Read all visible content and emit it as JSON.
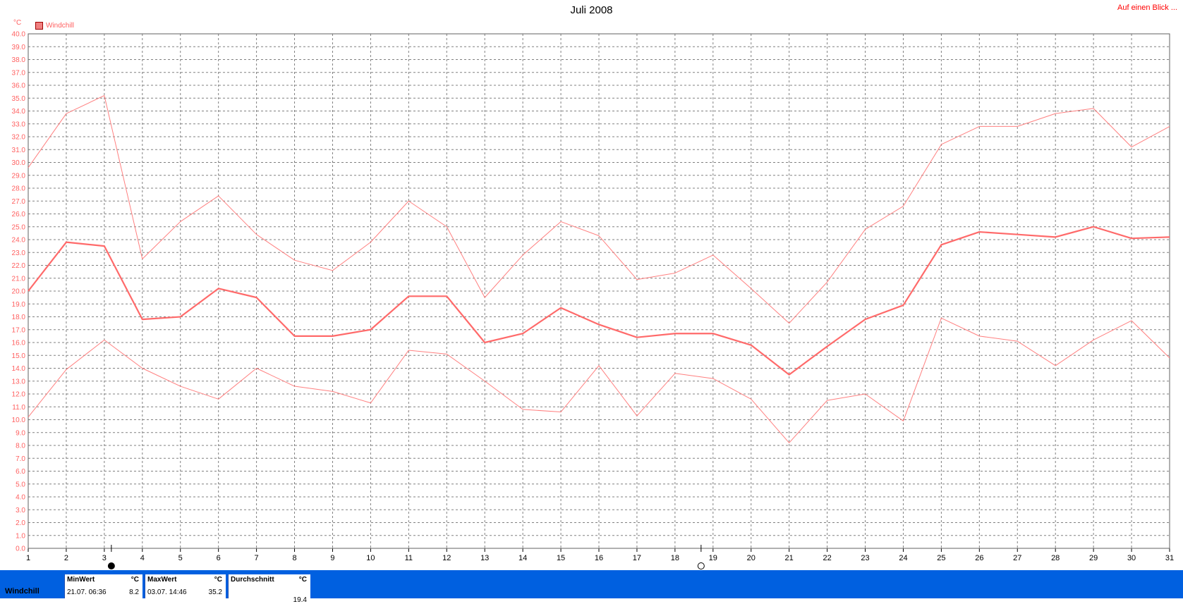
{
  "header": {
    "title": "Juli 2008",
    "link_label": "Auf einen Blick ..."
  },
  "chart_data": {
    "type": "line",
    "title": "Juli 2008",
    "y_unit": "°C",
    "ylim": [
      0,
      40
    ],
    "y_tick_step": 1,
    "x": [
      1,
      2,
      3,
      4,
      5,
      6,
      7,
      8,
      9,
      10,
      11,
      12,
      13,
      14,
      15,
      16,
      17,
      18,
      19,
      20,
      21,
      22,
      23,
      24,
      25,
      26,
      27,
      28,
      29,
      30,
      31
    ],
    "legend": [
      "Windchill"
    ],
    "legend_position": "top-left",
    "grid": true,
    "series": [
      {
        "name": "Windchill",
        "role": "max",
        "color": "#ff8080",
        "values": [
          29.6,
          33.8,
          35.2,
          22.5,
          25.4,
          27.4,
          24.4,
          22.4,
          21.6,
          23.8,
          27.0,
          25.0,
          19.5,
          22.8,
          25.4,
          24.3,
          20.9,
          21.4,
          22.8,
          20.2,
          17.5,
          20.7,
          24.8,
          26.6,
          31.4,
          32.8,
          32.8,
          33.8,
          34.2,
          31.2,
          32.8
        ]
      },
      {
        "name": "Windchill",
        "role": "avg",
        "color": "#ff6a6a",
        "values": [
          20.0,
          23.8,
          23.5,
          17.8,
          18.0,
          20.2,
          19.5,
          16.5,
          16.5,
          17.0,
          19.6,
          19.6,
          16.0,
          16.7,
          18.7,
          17.4,
          16.4,
          16.7,
          16.7,
          15.8,
          13.5,
          15.7,
          17.8,
          18.9,
          23.6,
          24.6,
          24.4,
          24.2,
          25.0,
          24.1,
          24.2
        ]
      },
      {
        "name": "Windchill",
        "role": "min",
        "color": "#ff8080",
        "values": [
          10.2,
          13.9,
          16.2,
          14.0,
          12.6,
          11.6,
          14.0,
          12.6,
          12.2,
          11.3,
          15.4,
          15.1,
          13.0,
          10.8,
          10.6,
          14.2,
          10.3,
          13.6,
          13.2,
          11.6,
          8.2,
          11.5,
          12.0,
          9.9,
          17.9,
          16.5,
          16.1,
          14.2,
          16.2,
          17.7,
          14.8
        ]
      }
    ],
    "markers": [
      {
        "day": 3,
        "icon": "full-moon-icon"
      },
      {
        "day": 18.5,
        "icon": "new-moon-icon"
      }
    ]
  },
  "stats": {
    "row_label": "Windchill",
    "min": {
      "label": "MinWert",
      "unit": "°C",
      "when": "21.07.  06:36",
      "value": "8.2"
    },
    "max": {
      "label": "MaxWert",
      "unit": "°C",
      "when": "03.07.  14:46",
      "value": "35.2"
    },
    "avg": {
      "label": "Durchschnitt",
      "unit": "°C",
      "when": "",
      "value": "19.4"
    }
  }
}
